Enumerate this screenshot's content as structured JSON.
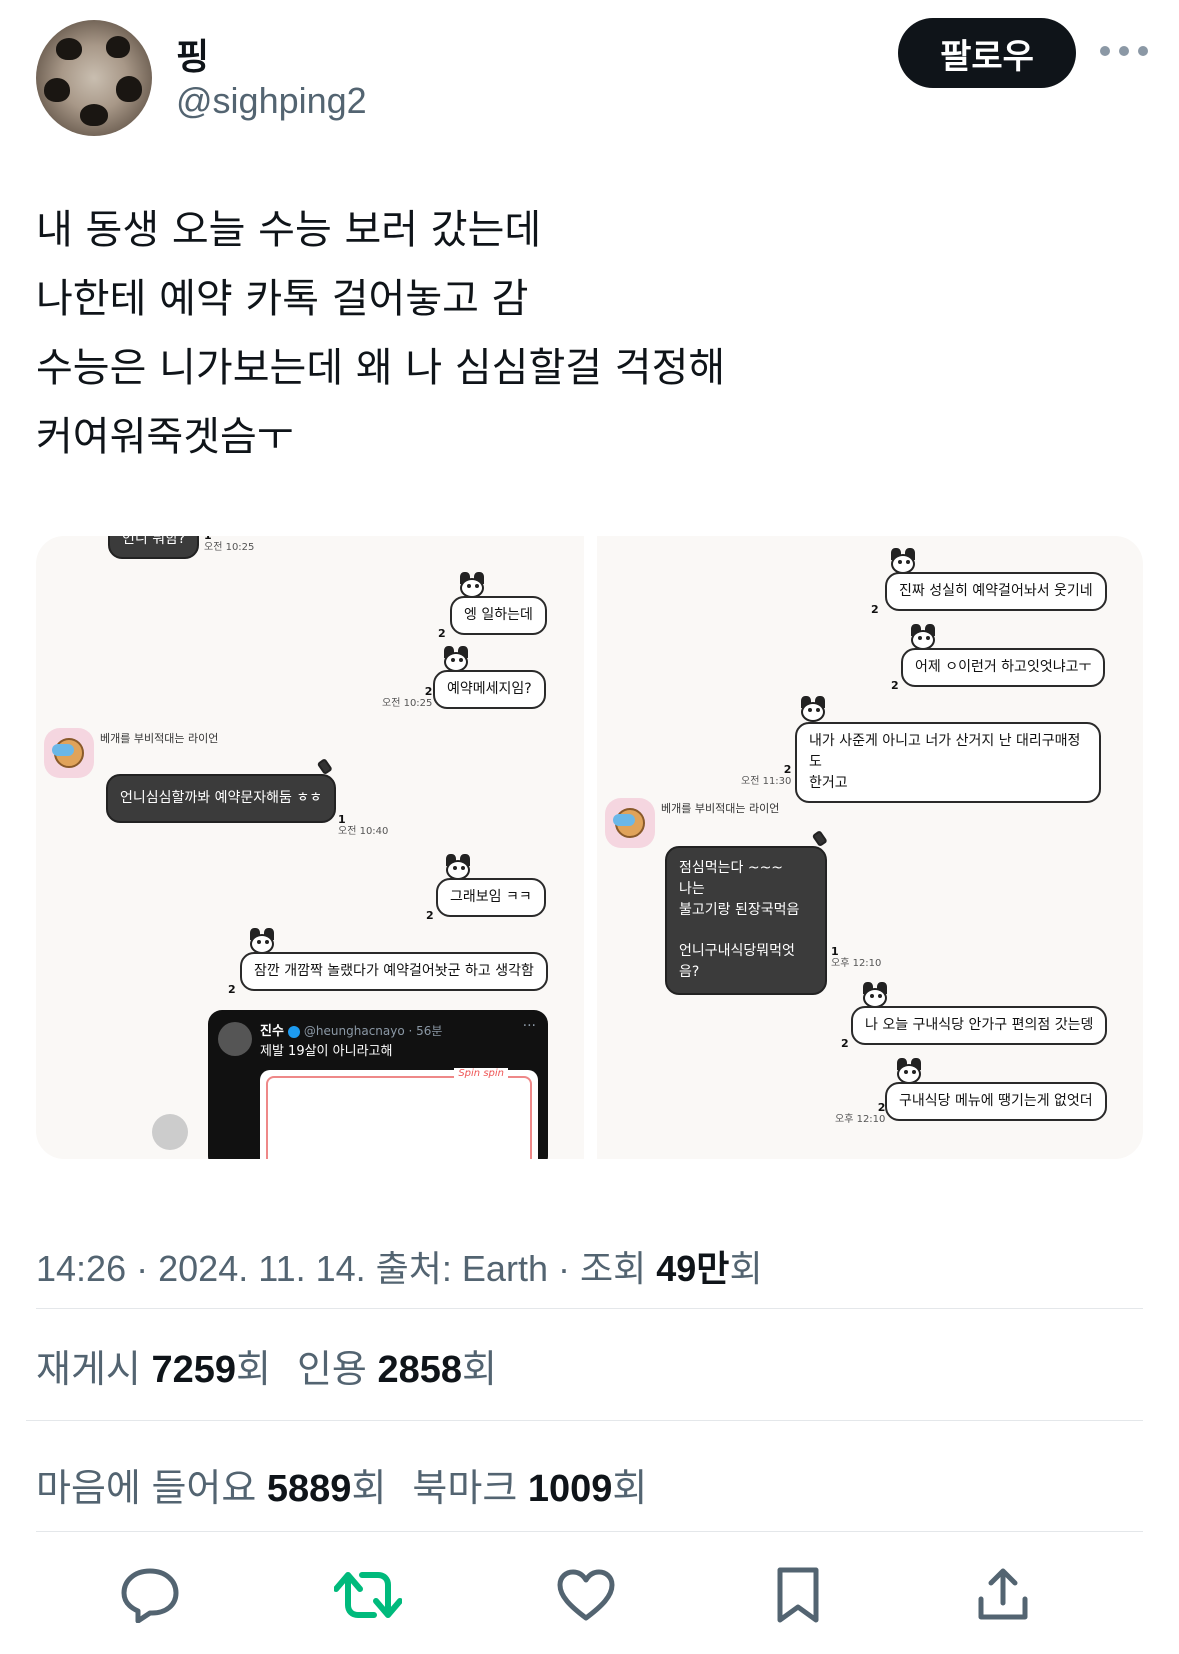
{
  "author": {
    "name": "핑",
    "handle": "@sighping2",
    "follow_label": "팔로우"
  },
  "tweet": {
    "lines": [
      "내 동생 오늘 수능 보러 갔는데",
      "나한테 예약 카톡 걸어놓고 감",
      "수능은 니가보는데 왜 나 심심할걸 걱정해",
      "커여워죽겟슴ㅜ"
    ]
  },
  "chat_left": {
    "top_bubble": "언니 뭐함?",
    "top_meta_count": "1",
    "top_meta_time": "오전 10:25",
    "m1": "엥 일하는데",
    "m1_count": "2",
    "m2": "예약메세지임?",
    "m2_count": "2",
    "m2_time": "오전 10:25",
    "sender": "베개를 부비적대는 라이언",
    "m3": "언니심심할까봐 예약문자해둠 ㅎㅎ",
    "m3_count": "1",
    "m3_time": "오전 10:40",
    "m4": "그래보임 ㅋㅋ",
    "m4_count": "2",
    "m5": "잠깐 개깜짝 놀랬다가 예약걸어놧군 하고 생각함",
    "m5_count": "2",
    "embed": {
      "user": "진수",
      "handle": "@heunghacnayo · 56분",
      "text": "제발 19살이 아니라고해",
      "more": "···",
      "card_logo": "Spin spin"
    }
  },
  "chat_right": {
    "m1": "진짜 성실히 예약걸어놔서 웃기네",
    "m1_count": "2",
    "m2": "어제 ㅇ이런거 하고잇엇냐고ㅜ",
    "m2_count": "2",
    "m3_line1": "내가 사준게 아니고 너가 산거지 난 대리구매정도",
    "m3_line2": "한거고",
    "m3_count": "2",
    "m3_time": "오전 11:30",
    "sender": "베개를 부비적대는 라이언",
    "m4_line1": "점심먹는다 ~~~",
    "m4_line2": "나는",
    "m4_line3": "불고기랑 된장국먹음",
    "m4_line4": "언니구내식당뭐먹엇음?",
    "m4_count": "1",
    "m4_time": "오후 12:10",
    "m5": "나 오늘 구내식당 안가구 편의점 갓는뎅",
    "m5_count": "2",
    "m6": "구내식당 메뉴에 땡기는게 없엇더",
    "m6_count": "2",
    "m6_time": "오후 12:10"
  },
  "meta": {
    "time": "14:26",
    "date": "2024. 11. 14.",
    "source_prefix": "출처:",
    "source": "Earth",
    "views_prefix": "조회",
    "views": "49만",
    "views_suffix": "회",
    "sep": "·"
  },
  "stats": {
    "repost_label": "재게시",
    "repost_count": "7259",
    "quote_label": "인용",
    "quote_count": "2858",
    "like_label": "마음에 들어요",
    "like_count": "5889",
    "bookmark_label": "북마크",
    "bookmark_count": "1009",
    "suffix": "회"
  },
  "colors": {
    "repost_green": "#00ba7c",
    "icon_gray": "#536471"
  },
  "icons": [
    "reply-icon",
    "repost-icon",
    "like-icon",
    "bookmark-icon",
    "share-icon"
  ]
}
